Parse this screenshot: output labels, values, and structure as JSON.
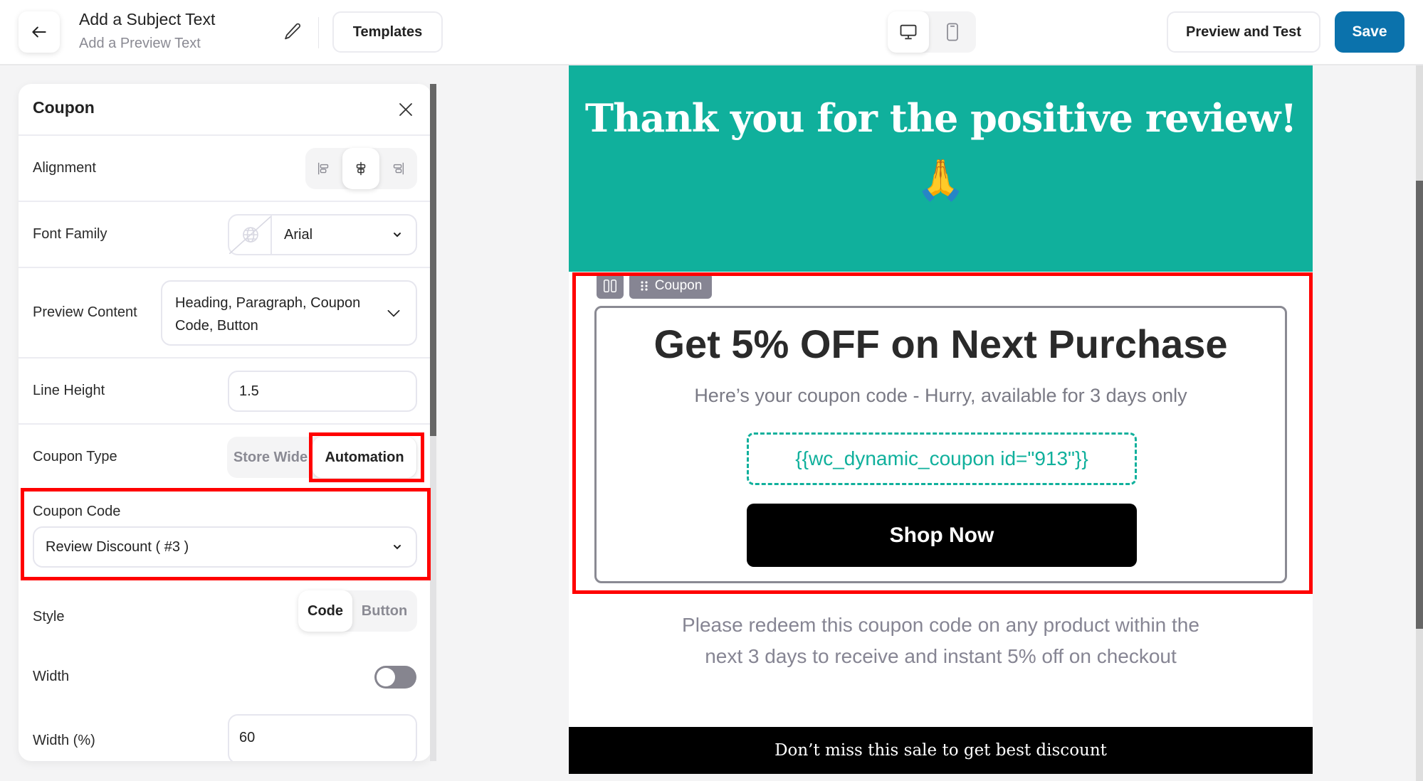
{
  "header": {
    "subject": "Add a Subject Text",
    "preview_text": "Add a Preview Text",
    "templates_label": "Templates",
    "preview_test_label": "Preview and Test",
    "save_label": "Save",
    "device": "desktop",
    "accent_color": "#0b72ac"
  },
  "panel": {
    "title": "Coupon",
    "alignment": {
      "label": "Alignment",
      "options": [
        "left",
        "center",
        "right"
      ],
      "selected": "center"
    },
    "font_family": {
      "label": "Font Family",
      "value": "Arial"
    },
    "preview_content": {
      "label": "Preview Content",
      "value": "Heading, Paragraph, Coupon Code, Button"
    },
    "line_height": {
      "label": "Line Height",
      "value": "1.5"
    },
    "coupon_type": {
      "label": "Coupon Type",
      "options": [
        "Store Wide",
        "Automation"
      ],
      "selected": "Automation"
    },
    "coupon_code": {
      "label": "Coupon Code",
      "value": "Review Discount ( #3 )"
    },
    "style": {
      "label": "Style",
      "options": [
        "Code",
        "Button"
      ],
      "selected": "Code"
    },
    "width_toggle": {
      "label": "Width",
      "on": false
    },
    "width_percent": {
      "label": "Width (%)",
      "value": "60"
    }
  },
  "email": {
    "banner_title": "Thank you for the positive review!",
    "banner_emoji": "🙏",
    "banner_color": "#10b09c",
    "block_tag": "Coupon",
    "coupon_heading": "Get 5% OFF on Next Purchase",
    "coupon_subtext": "Here’s your coupon code - Hurry, available for 3 days only",
    "coupon_code": "{{wc_dynamic_coupon id=\"913\"}}",
    "button_label": "Shop Now",
    "paragraph": "Please redeem this coupon code on any product within the next 3 days to receive and instant 5% off on checkout",
    "footer_text": "Don’t miss this sale to get best discount"
  }
}
